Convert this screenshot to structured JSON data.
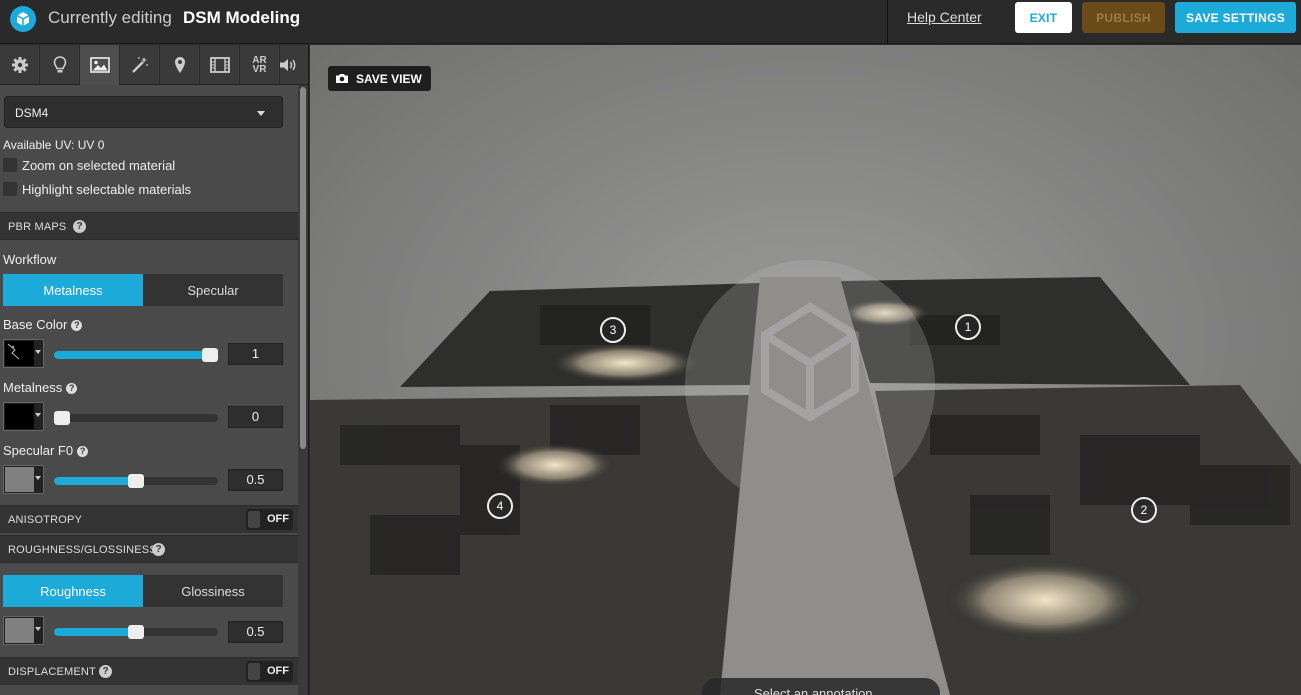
{
  "header": {
    "prefix": "Currently editing",
    "model_name": "DSM Modeling",
    "help_link": "Help Center",
    "exit_label": "EXIT",
    "publish_label": "PUBLISH",
    "save_label": "SAVE SETTINGS"
  },
  "tabs": [
    {
      "icon": "gear-icon"
    },
    {
      "icon": "lightbulb-icon"
    },
    {
      "icon": "image-icon",
      "active": true
    },
    {
      "icon": "magic-wand-icon"
    },
    {
      "icon": "map-pin-icon"
    },
    {
      "icon": "film-icon"
    },
    {
      "icon": "ar-vr-icon",
      "label_top": "AR",
      "label_bottom": "VR"
    },
    {
      "icon": "speaker-icon"
    }
  ],
  "material": {
    "selected": "DSM4",
    "uv_info": "Available UV: UV 0",
    "zoom_label": "Zoom on selected material",
    "highlight_label": "Highlight selectable materials"
  },
  "pbr": {
    "section_title": "PBR MAPS",
    "workflow_label": "Workflow",
    "workflow_options": [
      "Metalness",
      "Specular"
    ],
    "workflow_selected": "Metalness",
    "base_color": {
      "label": "Base Color",
      "value": "1",
      "fraction": 1.0,
      "color": "#000000"
    },
    "metalness": {
      "label": "Metalness",
      "value": "0",
      "fraction": 0.0,
      "color": "#000000"
    },
    "specular_f0": {
      "label": "Specular F0",
      "value": "0.5",
      "fraction": 0.5,
      "color": "#808080"
    }
  },
  "anisotropy": {
    "label": "ANISOTROPY",
    "state": "OFF"
  },
  "roughness": {
    "section_title": "ROUGHNESS/GLOSSINESS",
    "options": [
      "Roughness",
      "Glossiness"
    ],
    "selected": "Roughness",
    "value": "0.5",
    "fraction": 0.5,
    "color": "#808080"
  },
  "displacement": {
    "label": "DISPLACEMENT",
    "state": "OFF"
  },
  "viewport": {
    "save_view_label": "SAVE VIEW",
    "hotspots": [
      "1",
      "2",
      "3",
      "4"
    ],
    "annotation_prompt": "Select an annotation"
  },
  "colors": {
    "accent": "#1caad9",
    "publish": "#6a4a17"
  }
}
